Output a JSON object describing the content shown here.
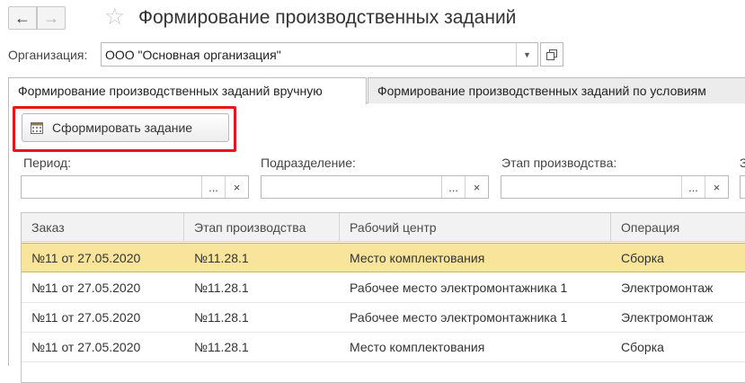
{
  "header": {
    "back_icon": "arrow-left-icon",
    "back_glyph": "←",
    "forward_icon": "arrow-right-icon",
    "forward_glyph": "→",
    "favorite_icon": "star-icon",
    "favorite_glyph": "☆",
    "title": "Формирование производственных заданий"
  },
  "organization": {
    "label": "Организация:",
    "value": "ООО \"Основная организация\"",
    "dropdown_glyph": "▼"
  },
  "tabs": [
    {
      "label": "Формирование производственных заданий вручную",
      "active": true
    },
    {
      "label": "Формирование производственных заданий по условиям",
      "active": false
    }
  ],
  "command": {
    "label": "Сформировать задание",
    "icon": "calendar-icon",
    "highlight_color": "#e8141b"
  },
  "filters": [
    {
      "label": "Период:",
      "value": "",
      "select_glyph": "...",
      "clear_glyph": "×"
    },
    {
      "label": "Подразделение:",
      "value": "",
      "select_glyph": "...",
      "clear_glyph": "×"
    },
    {
      "label": "Этап производства:",
      "value": "",
      "select_glyph": "...",
      "clear_glyph": "×"
    },
    {
      "label": "З",
      "value": ""
    }
  ],
  "table": {
    "columns": [
      "Заказ",
      "Этап производства",
      "Рабочий центр",
      "Операция"
    ],
    "rows": [
      [
        "№11 от 27.05.2020",
        "№11.28.1",
        "Место комплектования",
        "Сборка"
      ],
      [
        "№11 от 27.05.2020",
        "№11.28.1",
        "Рабочее место электромонтажника 1",
        "Электромонтаж"
      ],
      [
        "№11 от 27.05.2020",
        "№11.28.1",
        "Рабочее место электромонтажника 1",
        "Электромонтаж"
      ],
      [
        "№11 от 27.05.2020",
        "№11.28.1",
        "Место комплектования",
        "Сборка"
      ]
    ],
    "selected_row": 0,
    "selected_color": "#f8e49a"
  }
}
